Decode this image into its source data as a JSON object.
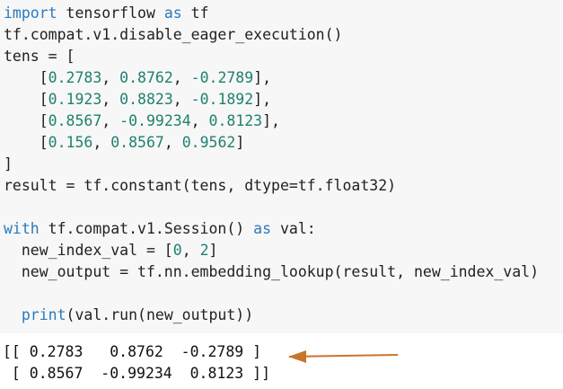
{
  "code": {
    "lines": [
      [
        {
          "t": "import",
          "c": "kw"
        },
        {
          "t": " tensorflow "
        },
        {
          "t": "as",
          "c": "kw"
        },
        {
          "t": " tf"
        }
      ],
      [
        {
          "t": "tf.compat.v1.disable_eager_execution()"
        }
      ],
      [
        {
          "t": "tens = ["
        }
      ],
      [
        {
          "t": "    ["
        },
        {
          "t": "0.2783",
          "c": "num"
        },
        {
          "t": ", "
        },
        {
          "t": "0.8762",
          "c": "num"
        },
        {
          "t": ", "
        },
        {
          "t": "-0.2789",
          "c": "num"
        },
        {
          "t": "],"
        }
      ],
      [
        {
          "t": "    ["
        },
        {
          "t": "0.1923",
          "c": "num"
        },
        {
          "t": ", "
        },
        {
          "t": "0.8823",
          "c": "num"
        },
        {
          "t": ", "
        },
        {
          "t": "-0.1892",
          "c": "num"
        },
        {
          "t": "],"
        }
      ],
      [
        {
          "t": "    ["
        },
        {
          "t": "0.8567",
          "c": "num"
        },
        {
          "t": ", "
        },
        {
          "t": "-0.99234",
          "c": "num"
        },
        {
          "t": ", "
        },
        {
          "t": "0.8123",
          "c": "num"
        },
        {
          "t": "],"
        }
      ],
      [
        {
          "t": "    ["
        },
        {
          "t": "0.156",
          "c": "num"
        },
        {
          "t": ", "
        },
        {
          "t": "0.8567",
          "c": "num"
        },
        {
          "t": ", "
        },
        {
          "t": "0.9562",
          "c": "num"
        },
        {
          "t": "]"
        }
      ],
      [
        {
          "t": "]"
        }
      ],
      [
        {
          "t": "result = tf.constant(tens, dtype=tf.float32)"
        }
      ],
      [
        {
          "t": ""
        }
      ],
      [
        {
          "t": "with",
          "c": "kw"
        },
        {
          "t": " tf.compat.v1.Session() "
        },
        {
          "t": "as",
          "c": "kw"
        },
        {
          "t": " val:"
        }
      ],
      [
        {
          "t": "  new_index_val = ["
        },
        {
          "t": "0",
          "c": "num"
        },
        {
          "t": ", "
        },
        {
          "t": "2",
          "c": "num"
        },
        {
          "t": "]"
        }
      ],
      [
        {
          "t": "  new_output = tf.nn.embedding_lookup(result, new_index_val)"
        }
      ],
      [
        {
          "t": ""
        }
      ],
      [
        {
          "t": "  "
        },
        {
          "t": "print",
          "c": "kw"
        },
        {
          "t": "(val.run(new_output))"
        }
      ]
    ]
  },
  "output": {
    "lines": [
      "[[ 0.2783   0.8762  -0.2789 ]",
      " [ 0.8567  -0.99234  0.8123 ]]"
    ]
  },
  "colors": {
    "code_background": "#f7f7f7",
    "keyword": "#2a7abf",
    "number": "#20806f",
    "text": "#212121",
    "arrow": "#c8762a"
  },
  "icons": {
    "annotation_arrow": "arrow-left-icon"
  }
}
